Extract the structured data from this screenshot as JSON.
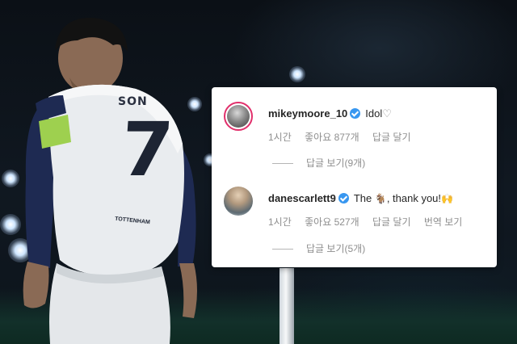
{
  "comments": [
    {
      "username": "mikeymoore_10",
      "verified": true,
      "text": "Idol",
      "text_suffix_icon": "heart-outline-icon",
      "time": "1시간",
      "likes": "좋아요 877개",
      "reply": "답글 달기",
      "view_replies": "답글 보기(9개)"
    },
    {
      "username": "danescarlett9",
      "verified": true,
      "text_before": "The",
      "emoji_1": "🐐",
      "text_after": ", thank you!",
      "emoji_2": "🙌",
      "time": "1시간",
      "likes": "좋아요 527개",
      "reply": "답글 달기",
      "translate": "번역 보기",
      "view_replies": "답글 보기(5개)"
    }
  ],
  "photo": {
    "jersey_name": "SON",
    "jersey_number": "7",
    "sponsor": "TOTTENHAM"
  },
  "colors": {
    "verified_badge": "#3897f0",
    "text_primary": "#262626",
    "text_secondary": "#8e8e8e",
    "card_bg": "#ffffff"
  }
}
